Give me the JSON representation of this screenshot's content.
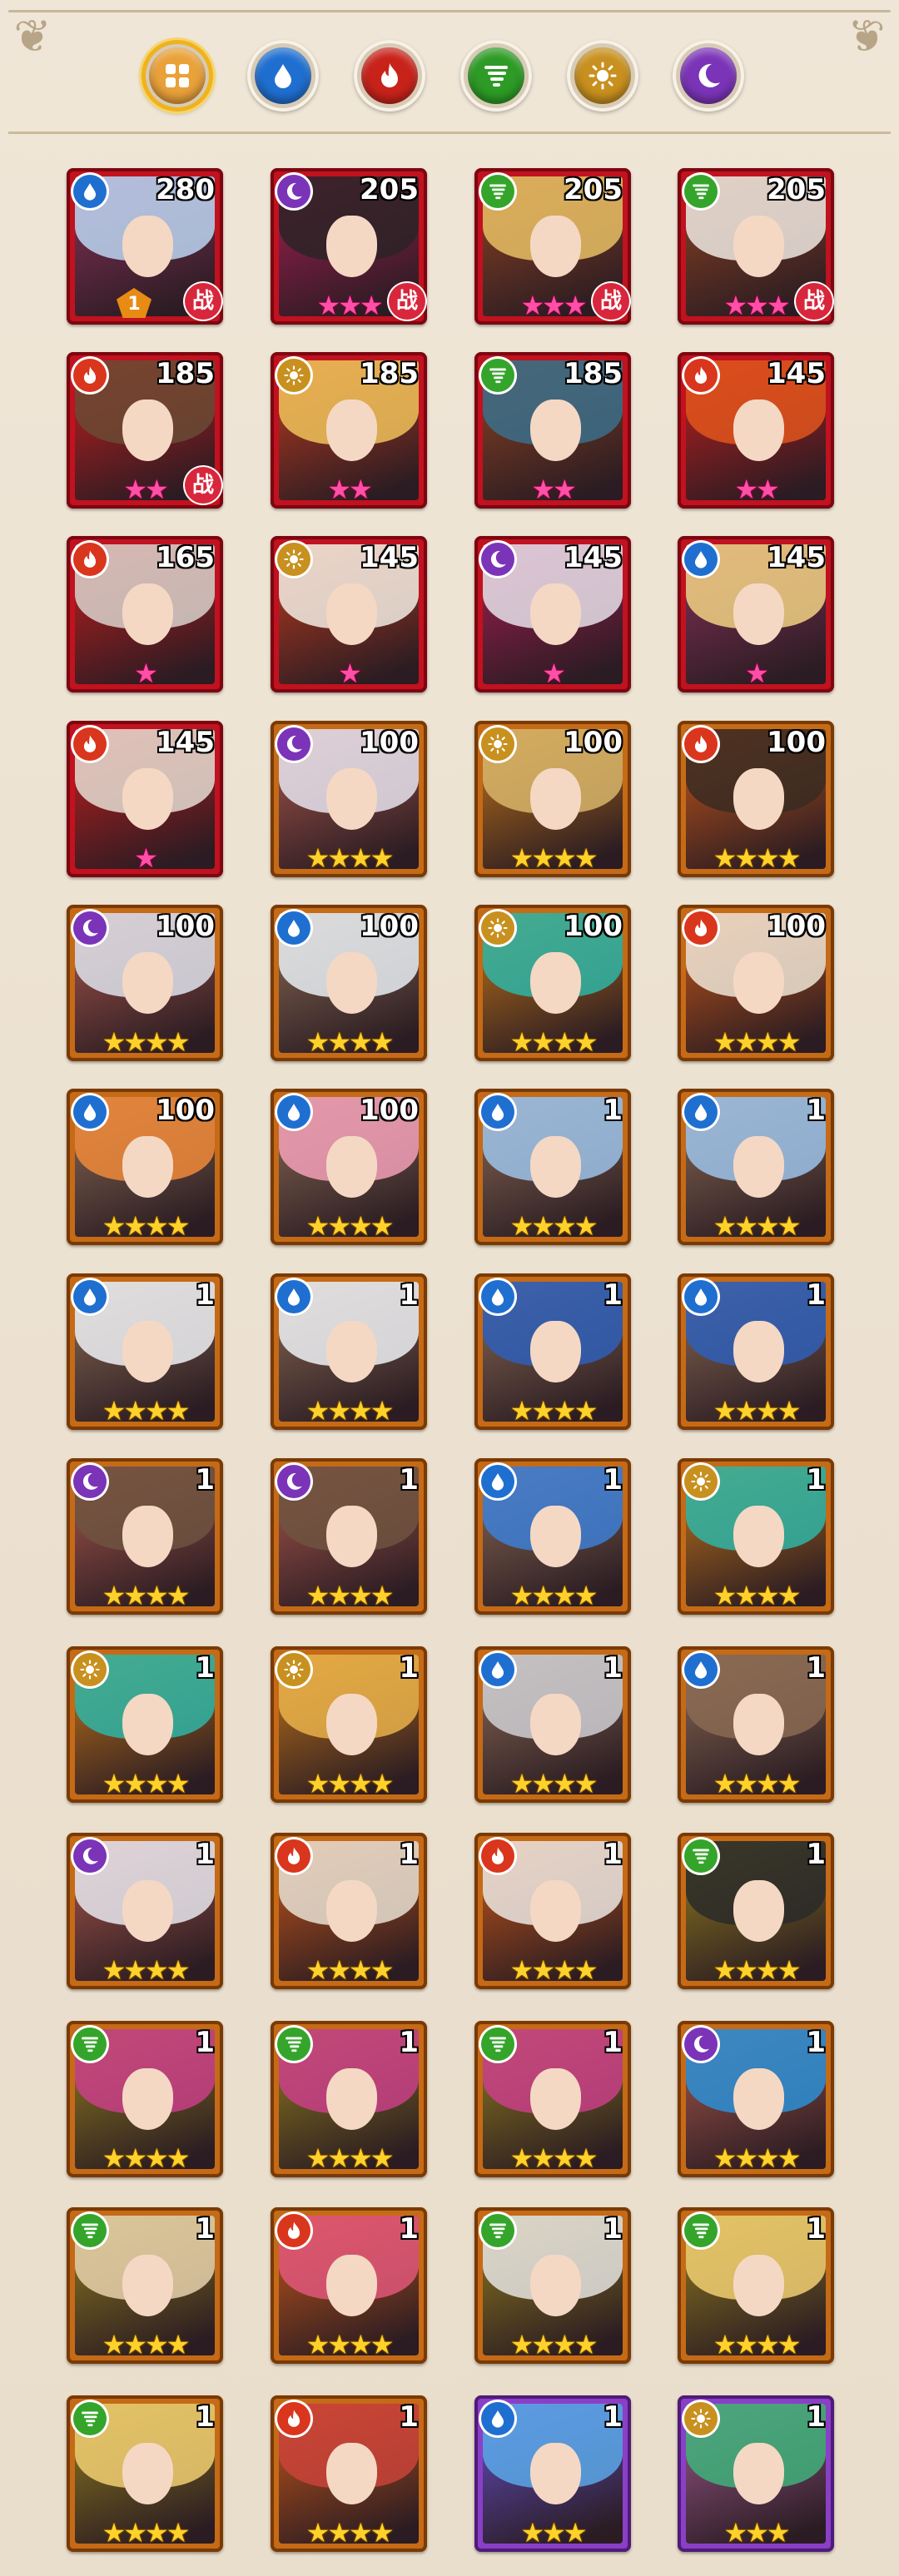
{
  "filters": [
    {
      "id": "all",
      "icon": "grid-icon",
      "color": "#e9a13a",
      "selected": true
    },
    {
      "id": "water",
      "icon": "water-drop-icon",
      "color": "#1f6fd1",
      "selected": false
    },
    {
      "id": "fire",
      "icon": "flame-icon",
      "color": "#c8231a",
      "selected": false
    },
    {
      "id": "wind",
      "icon": "tornado-icon",
      "color": "#2d9b25",
      "selected": false
    },
    {
      "id": "light",
      "icon": "sun-icon",
      "color": "#c8901e",
      "selected": false
    },
    {
      "id": "dark",
      "icon": "moon-icon",
      "color": "#7b34b8",
      "selected": false
    }
  ],
  "element_colors": {
    "water": "#1f6fd1",
    "fire": "#d9361d",
    "wind": "#34a52a",
    "light": "#c8901e",
    "dark": "#7b34b8"
  },
  "battle_label": "战",
  "heroes": [
    {
      "level": "280",
      "element": "water",
      "tier": "red",
      "stars": "",
      "star_color": "pink",
      "battle": true,
      "rank": "1",
      "hair": "#bcd6f2"
    },
    {
      "level": "205",
      "element": "dark",
      "tier": "red",
      "stars": "★★★",
      "star_color": "pink",
      "battle": true,
      "hair": "#2b2326"
    },
    {
      "level": "205",
      "element": "wind",
      "tier": "red",
      "stars": "★★★",
      "star_color": "pink",
      "battle": true,
      "hair": "#e8c064"
    },
    {
      "level": "205",
      "element": "wind",
      "tier": "red",
      "stars": "★★★",
      "star_color": "pink",
      "battle": true,
      "hair": "#efe9e2"
    },
    {
      "level": "185",
      "element": "fire",
      "tier": "red",
      "stars": "★★",
      "star_color": "pink",
      "battle": true,
      "hair": "#6b4a34"
    },
    {
      "level": "185",
      "element": "light",
      "tier": "red",
      "stars": "★★",
      "star_color": "pink",
      "battle": false,
      "hair": "#f0c25a"
    },
    {
      "level": "185",
      "element": "wind",
      "tier": "red",
      "stars": "★★",
      "star_color": "pink",
      "battle": false,
      "hair": "#3b6f8a"
    },
    {
      "level": "145",
      "element": "fire",
      "tier": "red",
      "stars": "★★",
      "star_color": "pink",
      "battle": false,
      "hair": "#e0551c"
    },
    {
      "level": "165",
      "element": "fire",
      "tier": "red",
      "stars": "★",
      "star_color": "pink",
      "battle": false,
      "hair": "#d9d2cc"
    },
    {
      "level": "145",
      "element": "light",
      "tier": "red",
      "stars": "★",
      "star_color": "pink",
      "battle": false,
      "hair": "#f3ede4"
    },
    {
      "level": "145",
      "element": "dark",
      "tier": "red",
      "stars": "★",
      "star_color": "pink",
      "battle": false,
      "hair": "#e6e1ea"
    },
    {
      "level": "145",
      "element": "water",
      "tier": "red",
      "stars": "★",
      "star_color": "pink",
      "battle": false,
      "hair": "#f1d284"
    },
    {
      "level": "145",
      "element": "fire",
      "tier": "red",
      "stars": "★",
      "star_color": "pink",
      "battle": false,
      "hair": "#e5ddd2"
    },
    {
      "level": "100",
      "element": "dark",
      "tier": "orange",
      "stars": "★★★★",
      "star_color": "gold",
      "battle": false,
      "hair": "#e7e4ef"
    },
    {
      "level": "100",
      "element": "light",
      "tier": "orange",
      "stars": "★★★★",
      "star_color": "gold",
      "battle": false,
      "hair": "#d7b56a"
    },
    {
      "level": "100",
      "element": "fire",
      "tier": "orange",
      "stars": "★★★★",
      "star_color": "gold",
      "battle": false,
      "hair": "#3a2b22"
    },
    {
      "level": "100",
      "element": "dark",
      "tier": "orange",
      "stars": "★★★★",
      "star_color": "gold",
      "battle": false,
      "hair": "#dfe3ec"
    },
    {
      "level": "100",
      "element": "water",
      "tier": "orange",
      "stars": "★★★★",
      "star_color": "gold",
      "battle": false,
      "hair": "#e9eef3"
    },
    {
      "level": "100",
      "element": "light",
      "tier": "orange",
      "stars": "★★★★",
      "star_color": "gold",
      "battle": false,
      "hair": "#2fb5a6"
    },
    {
      "level": "100",
      "element": "fire",
      "tier": "orange",
      "stars": "★★★★",
      "star_color": "gold",
      "battle": false,
      "hair": "#efe5d6"
    },
    {
      "level": "100",
      "element": "water",
      "tier": "orange",
      "stars": "★★★★",
      "star_color": "gold",
      "battle": false,
      "hair": "#f08a3a"
    },
    {
      "level": "100",
      "element": "water",
      "tier": "orange",
      "stars": "★★★★",
      "star_color": "gold",
      "battle": false,
      "hair": "#f3a0b8"
    },
    {
      "level": "1",
      "element": "water",
      "tier": "orange",
      "stars": "★★★★",
      "star_color": "gold",
      "battle": false,
      "hair": "#9ec3ea"
    },
    {
      "level": "1",
      "element": "water",
      "tier": "orange",
      "stars": "★★★★",
      "star_color": "gold",
      "battle": false,
      "hair": "#9ec3ea"
    },
    {
      "level": "1",
      "element": "water",
      "tier": "orange",
      "stars": "★★★★",
      "star_color": "gold",
      "battle": false,
      "hair": "#eef1f4"
    },
    {
      "level": "1",
      "element": "water",
      "tier": "orange",
      "stars": "★★★★",
      "star_color": "gold",
      "battle": false,
      "hair": "#eef1f4"
    },
    {
      "level": "1",
      "element": "water",
      "tier": "orange",
      "stars": "★★★★",
      "star_color": "gold",
      "battle": false,
      "hair": "#2f5fb8"
    },
    {
      "level": "1",
      "element": "water",
      "tier": "orange",
      "stars": "★★★★",
      "star_color": "gold",
      "battle": false,
      "hair": "#2f5fb8"
    },
    {
      "level": "1",
      "element": "dark",
      "tier": "orange",
      "stars": "★★★★",
      "star_color": "gold",
      "battle": false,
      "hair": "#6e5440"
    },
    {
      "level": "1",
      "element": "dark",
      "tier": "orange",
      "stars": "★★★★",
      "star_color": "gold",
      "battle": false,
      "hair": "#6e5440"
    },
    {
      "level": "1",
      "element": "water",
      "tier": "orange",
      "stars": "★★★★",
      "star_color": "gold",
      "battle": false,
      "hair": "#3d7fd6"
    },
    {
      "level": "1",
      "element": "light",
      "tier": "orange",
      "stars": "★★★★",
      "star_color": "gold",
      "battle": false,
      "hair": "#2fb5a6"
    },
    {
      "level": "1",
      "element": "light",
      "tier": "orange",
      "stars": "★★★★",
      "star_color": "gold",
      "battle": false,
      "hair": "#2fb5a6"
    },
    {
      "level": "1",
      "element": "light",
      "tier": "orange",
      "stars": "★★★★",
      "star_color": "gold",
      "battle": false,
      "hair": "#e9b24a"
    },
    {
      "level": "1",
      "element": "water",
      "tier": "orange",
      "stars": "★★★★",
      "star_color": "gold",
      "battle": false,
      "hair": "#cfcfd4"
    },
    {
      "level": "1",
      "element": "water",
      "tier": "orange",
      "stars": "★★★★",
      "star_color": "gold",
      "battle": false,
      "hair": "#8a6a52"
    },
    {
      "level": "1",
      "element": "dark",
      "tier": "orange",
      "stars": "★★★★",
      "star_color": "gold",
      "battle": false,
      "hair": "#e7e7ef"
    },
    {
      "level": "1",
      "element": "fire",
      "tier": "orange",
      "stars": "★★★★",
      "star_color": "gold",
      "battle": false,
      "hair": "#e8e0d4"
    },
    {
      "level": "1",
      "element": "fire",
      "tier": "orange",
      "stars": "★★★★",
      "star_color": "gold",
      "battle": false,
      "hair": "#ece7e3"
    },
    {
      "level": "1",
      "element": "wind",
      "tier": "orange",
      "stars": "★★★★",
      "star_color": "gold",
      "battle": false,
      "hair": "#2a2a2a"
    },
    {
      "level": "1",
      "element": "wind",
      "tier": "orange",
      "stars": "★★★★",
      "star_color": "gold",
      "battle": false,
      "hair": "#c93f88"
    },
    {
      "level": "1",
      "element": "wind",
      "tier": "orange",
      "stars": "★★★★",
      "star_color": "gold",
      "battle": false,
      "hair": "#c93f88"
    },
    {
      "level": "1",
      "element": "wind",
      "tier": "orange",
      "stars": "★★★★",
      "star_color": "gold",
      "battle": false,
      "hair": "#c93f88"
    },
    {
      "level": "1",
      "element": "dark",
      "tier": "orange",
      "stars": "★★★★",
      "star_color": "gold",
      "battle": false,
      "hair": "#2b8fd6"
    },
    {
      "level": "1",
      "element": "wind",
      "tier": "orange",
      "stars": "★★★★",
      "star_color": "gold",
      "battle": false,
      "hair": "#e7d2ad"
    },
    {
      "level": "1",
      "element": "fire",
      "tier": "orange",
      "stars": "★★★★",
      "star_color": "gold",
      "battle": false,
      "hair": "#e0577a"
    },
    {
      "level": "1",
      "element": "wind",
      "tier": "orange",
      "stars": "★★★★",
      "star_color": "gold",
      "battle": false,
      "hair": "#e6e4e2"
    },
    {
      "level": "1",
      "element": "wind",
      "tier": "orange",
      "stars": "★★★★",
      "star_color": "gold",
      "battle": false,
      "hair": "#f1cf72"
    },
    {
      "level": "1",
      "element": "wind",
      "tier": "orange",
      "stars": "★★★★",
      "star_color": "gold",
      "battle": false,
      "hair": "#f1cf72"
    },
    {
      "level": "1",
      "element": "fire",
      "tier": "orange",
      "stars": "★★★★",
      "star_color": "gold",
      "battle": false,
      "hair": "#c9433a"
    },
    {
      "level": "1",
      "element": "water",
      "tier": "purple",
      "stars": "★★★",
      "star_color": "gold",
      "battle": false,
      "hair": "#5aa8e8"
    },
    {
      "level": "1",
      "element": "light",
      "tier": "purple",
      "stars": "★★★",
      "star_color": "gold",
      "battle": false,
      "hair": "#3fb27a"
    }
  ]
}
